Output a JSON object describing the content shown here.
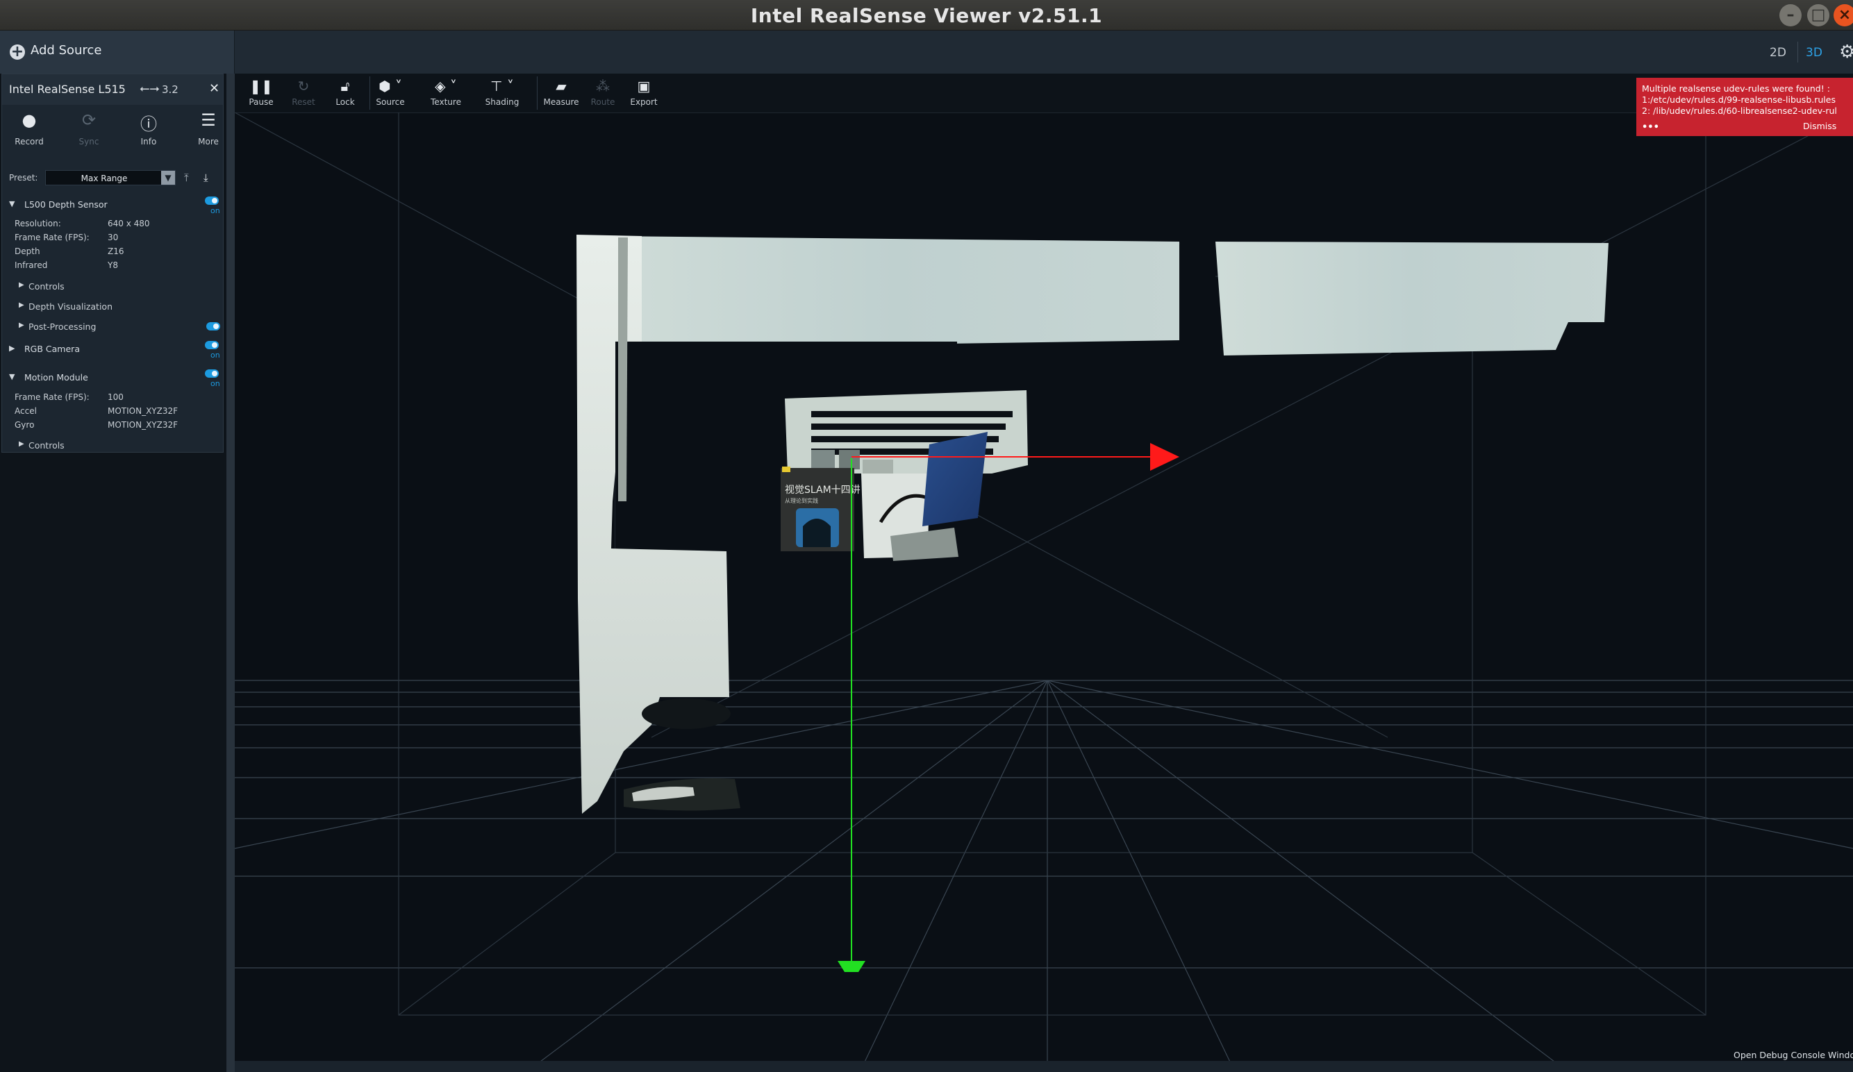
{
  "window": {
    "title": "Intel RealSense Viewer v2.51.1"
  },
  "topbar": {
    "add_source_label": "Add Source",
    "view_2d_label": "2D",
    "view_3d_label": "3D",
    "active_view": "3D"
  },
  "device": {
    "name": "Intel RealSense L515",
    "usb_version": "3.2",
    "buttons": [
      {
        "label": "Record",
        "icon": "record-icon",
        "enabled": true
      },
      {
        "label": "Sync",
        "icon": "sync-icon",
        "enabled": false
      },
      {
        "label": "Info",
        "icon": "info-icon",
        "enabled": true
      },
      {
        "label": "More",
        "icon": "menu-icon",
        "enabled": true
      }
    ],
    "preset_label": "Preset:",
    "preset_value": "Max Range",
    "sensors": {
      "depth": {
        "name": "L500 Depth Sensor",
        "toggle": "on",
        "expanded": true,
        "props": [
          {
            "key": "Resolution:",
            "value": "640 x 480"
          },
          {
            "key": "Frame Rate (FPS):",
            "value": "30"
          },
          {
            "key": "Depth",
            "value": "Z16"
          },
          {
            "key": "Infrared",
            "value": "Y8"
          }
        ],
        "sub": [
          "Controls",
          "Depth Visualization",
          "Post-Processing"
        ]
      },
      "rgb": {
        "name": "RGB Camera",
        "toggle": "on",
        "expanded": false
      },
      "motion": {
        "name": "Motion Module",
        "toggle": "on",
        "expanded": true,
        "props": [
          {
            "key": "Frame Rate (FPS):",
            "value": "100"
          },
          {
            "key": "Accel",
            "value": "MOTION_XYZ32F"
          },
          {
            "key": "Gyro",
            "value": "MOTION_XYZ32F"
          }
        ],
        "sub": [
          "Controls"
        ]
      }
    }
  },
  "toolbar": {
    "tools": [
      {
        "label": "Pause",
        "icon": "pause-icon",
        "enabled": true
      },
      {
        "label": "Reset",
        "icon": "reset-icon",
        "enabled": false
      },
      {
        "label": "Lock",
        "icon": "lock-icon",
        "enabled": true
      },
      {
        "label": "Source",
        "icon": "cube-icon",
        "enabled": true
      },
      {
        "label": "Texture",
        "icon": "paint-bucket-icon",
        "enabled": true
      },
      {
        "label": "Shading",
        "icon": "paint-roller-icon",
        "enabled": true
      },
      {
        "label": "Measure",
        "icon": "ruler-icon",
        "enabled": true
      },
      {
        "label": "Route",
        "icon": "paw-icon",
        "enabled": false
      },
      {
        "label": "Export",
        "icon": "save-icon",
        "enabled": true
      }
    ]
  },
  "notification": {
    "text": "Multiple realsense udev-rules were found! :\n1:/etc/udev/rules.d/99-realsense-libusb.rules\n2: /lib/udev/rules.d/60-librealsense2-udev-rul",
    "more": "•••",
    "dismiss_label": "Dismiss",
    "color": "#c7232f"
  },
  "scene": {
    "book_title": "视觉SLAM十四讲",
    "book_subtitle": "从理论到实践",
    "axis_colors": {
      "x": "#ff1a1a",
      "y": "#22e022"
    }
  },
  "footer": {
    "debug_console_label": "Open Debug Console Windo"
  },
  "colors": {
    "accent": "#1c9be0",
    "titlebar": "#3d3d3a",
    "close_button": "#e95420"
  }
}
